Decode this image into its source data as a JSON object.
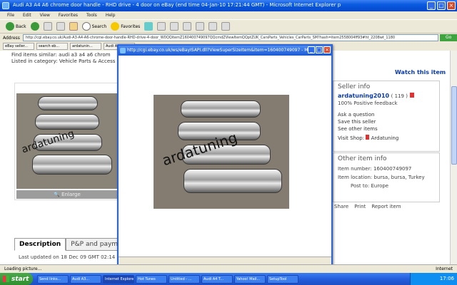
{
  "window": {
    "title": "Audi A3 A4 A6 chrome door handle - RHD drive - 4 door on eBay (end time 04-Jan-10 17:21:44 GMT) - Microsoft Internet Explorer p"
  },
  "menu": [
    "File",
    "Edit",
    "View",
    "Favorites",
    "Tools",
    "Help"
  ],
  "toolbar": {
    "back": "Back",
    "search": "Search",
    "favorites": "Favorites"
  },
  "address": {
    "label": "Address",
    "url": "http://cgi.ebay.co.uk/Audi-A3-A4-A6-chrome-door-handle-RHD-drive-4-door_W0QQitemZ160400749097QQcmdZViewItemQQptZUK_CarsParts_Vehicles_CarParts_SM?hash=item2558004ff93#ht_2208wt_1180",
    "go": "Go"
  },
  "tabs": [
    "eBay seller...",
    "search eb...",
    "ardatunin...",
    "Audi A3 A4..."
  ],
  "page": {
    "find_similar_1": "Find items similar: audi a3 a4 a6 chrom",
    "find_similar_2": "Listed in category: Vehicle Parts & Access",
    "watermark": "ardatuning",
    "enlarge": "Enlarge",
    "tab_description": "Description",
    "tab_postage": "P&P and payme",
    "last_updated": "Last updated on 18 Dec 09 GMT 02:14 ... 21",
    "watch": "Watch this item",
    "seller": {
      "heading": "Seller info",
      "name": "ardatuning2010",
      "score": "( 119 )",
      "feedback": "100% Positive feedback",
      "ask": "Ask a question",
      "save": "Save this seller",
      "other": "See other items",
      "visit": "Visit Shop:",
      "shop": "Ardatuning"
    },
    "other_info": {
      "heading": "Other item info",
      "item_number": "Item number: 160400749097",
      "location": "Item location: bursa, bursa, Turkey",
      "post_to": "Post to: Europe"
    },
    "share": [
      "Share",
      "Print",
      "Report item"
    ]
  },
  "popup": {
    "title": "http://cgi.ebay.co.uk/ws/eBayISAPI.dll?ViewSuperSizeItem&item=160400749097 - Mi...",
    "watermark": "ardatuning"
  },
  "status": {
    "left": "Loading picture...",
    "right": "Internet"
  },
  "taskbar": {
    "start": "start",
    "tasks": [
      "Send links...",
      "Audi A3...",
      "Internet Explorer",
      "Hot Tunes",
      "Untitled - ...",
      "Audi A4 T...",
      "Yahoo! Mail...",
      "SetupTool"
    ],
    "clock": "17:06"
  },
  "colors": {
    "link": "#0b3aa8",
    "xp_blue": "#245edc",
    "start_green": "#2f8f2f"
  }
}
